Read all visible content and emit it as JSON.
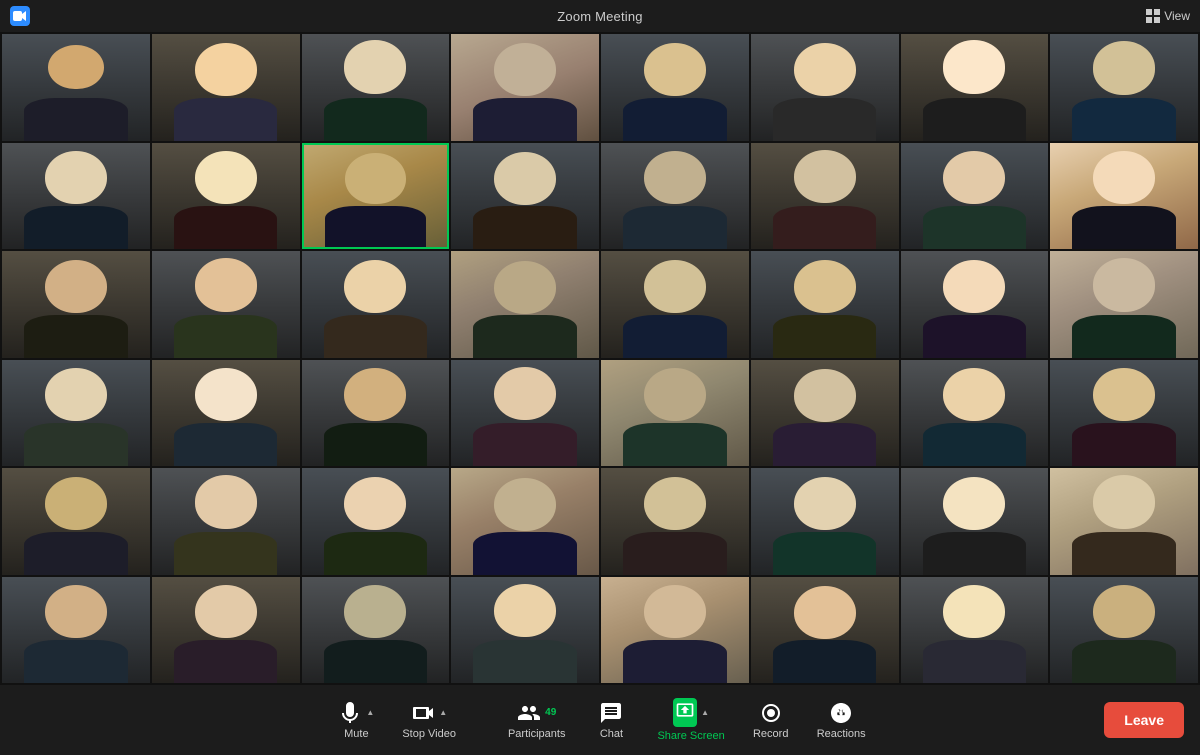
{
  "titlebar": {
    "title": "Zoom Meeting",
    "view_label": "View"
  },
  "toolbar": {
    "mute_label": "Mute",
    "stop_video_label": "Stop Video",
    "participants_label": "Participants",
    "participants_count": "49",
    "chat_label": "Chat",
    "share_screen_label": "Share Screen",
    "record_label": "Record",
    "reactions_label": "Reactions",
    "leave_label": "Leave"
  },
  "grid": {
    "rows": 6,
    "cols": 8,
    "total": 48
  }
}
